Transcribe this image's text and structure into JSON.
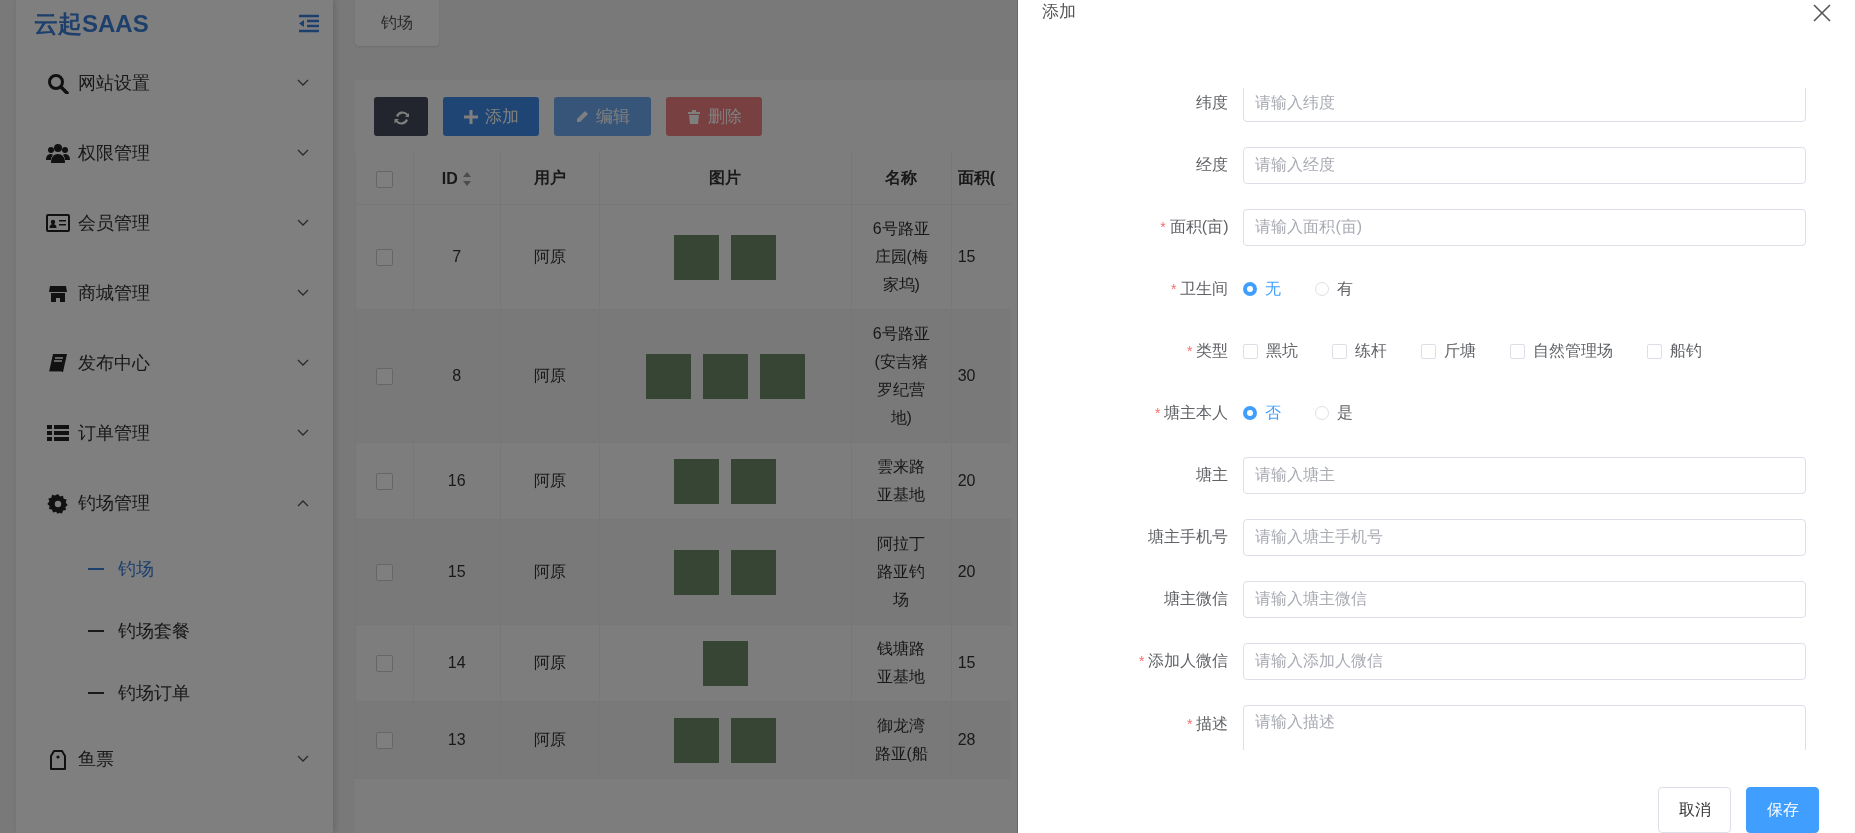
{
  "sidebar": {
    "logo": "云起SAAS",
    "items": [
      {
        "label": "网站设置",
        "expanded": false
      },
      {
        "label": "权限管理",
        "expanded": false
      },
      {
        "label": "会员管理",
        "expanded": false
      },
      {
        "label": "商城管理",
        "expanded": false
      },
      {
        "label": "发布中心",
        "expanded": false
      },
      {
        "label": "订单管理",
        "expanded": false
      },
      {
        "label": "钓场管理",
        "expanded": true,
        "children": [
          {
            "label": "钓场",
            "selected": true
          },
          {
            "label": "钓场套餐",
            "selected": false
          },
          {
            "label": "钓场订单",
            "selected": false
          }
        ]
      },
      {
        "label": "鱼票",
        "expanded": false
      }
    ]
  },
  "tabs": [
    {
      "label": "钓场"
    }
  ],
  "toolbar": [
    {
      "kind": "refresh",
      "disabled": false
    },
    {
      "kind": "add",
      "label": "添加",
      "disabled": false
    },
    {
      "kind": "edit",
      "label": "编辑",
      "disabled": true
    },
    {
      "kind": "delete",
      "label": "删除",
      "disabled": true
    }
  ],
  "table": {
    "select_all": {
      "checked": false
    },
    "columns": [
      {
        "label": "ID",
        "sortable": true
      },
      {
        "label": "用户",
        "sortable": false
      },
      {
        "label": "图片",
        "sortable": false
      },
      {
        "label": "名称",
        "sortable": false
      },
      {
        "label": "面积(",
        "sortable": false
      }
    ],
    "rows": [
      {
        "checked": false,
        "id": "7",
        "user": "阿原",
        "photos": [
          {
            "kind": "photo"
          },
          {
            "kind": "photo"
          }
        ],
        "name": "6号路亚庄园(梅家坞)",
        "column_5": "15"
      },
      {
        "checked": false,
        "id": "8",
        "user": "阿原",
        "photos": [
          {
            "kind": "photo"
          },
          {
            "kind": "photo"
          },
          {
            "kind": "photo"
          }
        ],
        "name": "6号路亚(安吉猪罗纪营地)",
        "column_5": "30"
      },
      {
        "checked": false,
        "id": "16",
        "user": "阿原",
        "photos": [
          {
            "kind": "photo"
          },
          {
            "kind": "photo"
          }
        ],
        "name": "雲来路亚基地",
        "column_5": "20"
      },
      {
        "checked": false,
        "id": "15",
        "user": "阿原",
        "photos": [
          {
            "kind": "photo"
          },
          {
            "kind": "photo"
          }
        ],
        "name": "阿拉丁路亚钓场",
        "column_5": "20"
      },
      {
        "checked": false,
        "id": "14",
        "user": "阿原",
        "photos": [
          {
            "kind": "photo"
          }
        ],
        "name": "钱塘路亚基地",
        "column_5": "15"
      },
      {
        "checked": false,
        "id": "13",
        "user": "阿原",
        "photos": [
          {
            "kind": "photo"
          },
          {
            "kind": "photo"
          }
        ],
        "name": "御龙湾路亚(船",
        "column_5": "28"
      }
    ]
  },
  "drawer": {
    "title": "添加",
    "fields": [
      {
        "kind": "input",
        "label": "纬度",
        "placeholder": "请输入纬度"
      },
      {
        "kind": "input",
        "label": "经度",
        "placeholder": "请输入经度"
      },
      {
        "kind": "input",
        "required_mark": "*",
        "label": "面积(亩)",
        "placeholder": "请输入面积(亩)"
      },
      {
        "kind": "radio",
        "required_mark": "*",
        "label": "卫生间",
        "options": [
          {
            "label": "无",
            "selected": true
          },
          {
            "label": "有",
            "selected": false
          }
        ]
      },
      {
        "kind": "checkbox",
        "required_mark": "*",
        "label": "类型",
        "options": [
          {
            "label": "黑坑",
            "checked": false
          },
          {
            "label": "练杆",
            "checked": false
          },
          {
            "label": "斤塘",
            "checked": false
          },
          {
            "label": "自然管理场",
            "checked": false
          },
          {
            "label": "船钓",
            "checked": false
          }
        ]
      },
      {
        "kind": "radio",
        "required_mark": "*",
        "label": "塘主本人",
        "options": [
          {
            "label": "否",
            "selected": true
          },
          {
            "label": "是",
            "selected": false
          }
        ]
      },
      {
        "kind": "input",
        "label": "塘主",
        "placeholder": "请输入塘主"
      },
      {
        "kind": "input",
        "label": "塘主手机号",
        "placeholder": "请输入塘主手机号"
      },
      {
        "kind": "input",
        "label": "塘主微信",
        "placeholder": "请输入塘主微信"
      },
      {
        "kind": "input",
        "required_mark": "*",
        "label": "添加人微信",
        "placeholder": "请输入添加人微信"
      },
      {
        "kind": "textarea",
        "required_mark": "*",
        "label": "描述",
        "placeholder": "请输入描述"
      }
    ],
    "buttons": [
      {
        "kind": "default",
        "label": "取消"
      },
      {
        "kind": "primary",
        "label": "保存"
      }
    ]
  }
}
